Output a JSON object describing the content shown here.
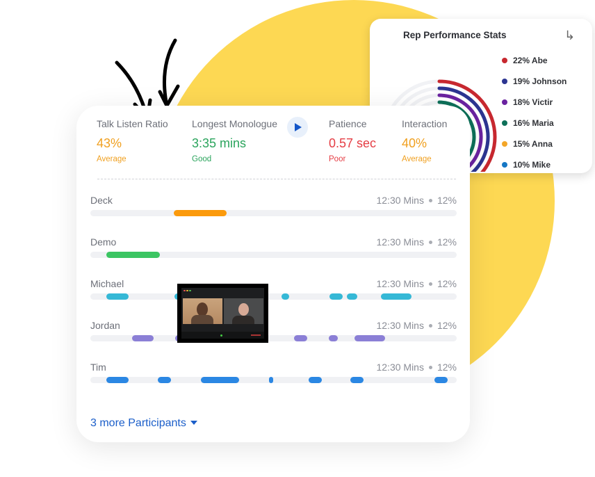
{
  "rep_performance": {
    "title": "Rep Performance Stats",
    "expand_icon": "redirect-arrow-icon",
    "chart_data": {
      "type": "radial-bar",
      "title": "Rep Performance Stats",
      "series": [
        {
          "name": "Abe",
          "value": 22,
          "label": "22% Abe",
          "color": "#c7282f"
        },
        {
          "name": "Johnson",
          "value": 19,
          "label": "19% Johnson",
          "color": "#2c3591"
        },
        {
          "name": "Victir",
          "value": 18,
          "label": "18% Victir",
          "color": "#6a22a0"
        },
        {
          "name": "Maria",
          "value": 16,
          "label": "16% Maria",
          "color": "#0d7059"
        },
        {
          "name": "Anna",
          "value": 15,
          "label": "15% Anna",
          "color": "#f3a628"
        },
        {
          "name": "Mike",
          "value": 10,
          "label": "10% Mike",
          "color": "#1677c4"
        }
      ],
      "legend": "right"
    }
  },
  "metrics": [
    {
      "label": "Talk Listen Ratio",
      "value": "43%",
      "status": "Average",
      "color": "#f0a020"
    },
    {
      "label": "Longest Monologue",
      "value": "3:35 mins",
      "status": "Good",
      "color": "#2aa45c"
    },
    {
      "label": "Patience",
      "value": "0.57 sec",
      "status": "Poor",
      "color": "#e53d44"
    },
    {
      "label": "Interaction",
      "value": "40%",
      "status": "Average",
      "color": "#f0a020"
    }
  ],
  "play_icon": "play-icon",
  "rows": [
    {
      "name": "Deck",
      "duration": "12:30 Mins",
      "percent": "12%",
      "color": "#fb9a0c",
      "segments": [
        [
          0.228,
          0.372
        ]
      ]
    },
    {
      "name": "Demo",
      "duration": "12:30 Mins",
      "percent": "12%",
      "color": "#3bc562",
      "segments": [
        [
          0.044,
          0.19
        ]
      ]
    },
    {
      "name": "Michael",
      "duration": "12:30 Mins",
      "percent": "12%",
      "color": "#35b8d6",
      "segments": [
        [
          0.044,
          0.104
        ],
        [
          0.23,
          0.26
        ],
        [
          0.522,
          0.542
        ],
        [
          0.652,
          0.689
        ],
        [
          0.7,
          0.728
        ],
        [
          0.794,
          0.876
        ]
      ]
    },
    {
      "name": "Jordan",
      "duration": "12:30 Mins",
      "percent": "12%",
      "color": "#8b7fd6",
      "segments": [
        [
          0.114,
          0.172
        ],
        [
          0.232,
          0.268
        ],
        [
          0.302,
          0.406
        ],
        [
          0.44,
          0.452
        ],
        [
          0.556,
          0.592
        ],
        [
          0.65,
          0.676
        ],
        [
          0.722,
          0.804
        ]
      ]
    },
    {
      "name": "Tim",
      "duration": "12:30 Mins",
      "percent": "12%",
      "color": "#2b87e3",
      "segments": [
        [
          0.044,
          0.104
        ],
        [
          0.184,
          0.22
        ],
        [
          0.302,
          0.406
        ],
        [
          0.488,
          0.5
        ],
        [
          0.596,
          0.632
        ],
        [
          0.71,
          0.746
        ],
        [
          0.94,
          0.976
        ]
      ]
    }
  ],
  "more_participants": "3 more Participants",
  "video_thumbnail": "video-call-thumbnail"
}
